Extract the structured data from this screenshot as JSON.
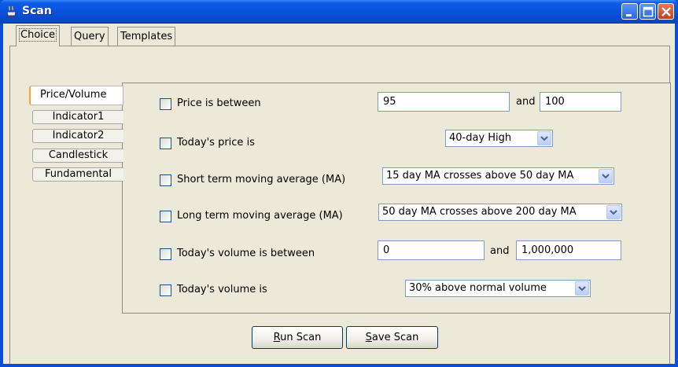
{
  "window": {
    "title": "Scan"
  },
  "tabs": [
    {
      "label": "Choice"
    },
    {
      "label": "Query"
    },
    {
      "label": "Templates"
    }
  ],
  "side_tabs": [
    {
      "label": "Price/Volume"
    },
    {
      "label": "Indicator1"
    },
    {
      "label": "Indicator2"
    },
    {
      "label": "Candlestick"
    },
    {
      "label": "Fundamental"
    }
  ],
  "criteria": {
    "price_between": {
      "label": "Price is between",
      "from": "95",
      "and": "and",
      "to": "100"
    },
    "todays_price": {
      "label": "Today's price is",
      "selected": "40-day High"
    },
    "short_ma": {
      "label": "Short term moving average (MA)",
      "selected": "15 day MA crosses above 50 day MA"
    },
    "long_ma": {
      "label": "Long term moving average (MA)",
      "selected": "50 day MA crosses above 200 day MA"
    },
    "volume_between": {
      "label": "Today's volume is between",
      "from": "0",
      "and": "and",
      "to": "1,000,000"
    },
    "todays_volume": {
      "label": "Today's volume is",
      "selected": "30% above normal volume"
    }
  },
  "buttons": {
    "run_scan": {
      "mnemonic": "R",
      "rest": "un Scan"
    },
    "save_scan": {
      "mnemonic": "S",
      "rest": "ave Scan"
    }
  },
  "colors": {
    "titlebar": "#0a51dc",
    "window_bg": "#ece9d8",
    "accent_tab": "#f5a52a"
  },
  "icons": [
    "app-icon",
    "minimize-icon",
    "maximize-icon",
    "close-icon",
    "chevron-down-icon"
  ]
}
